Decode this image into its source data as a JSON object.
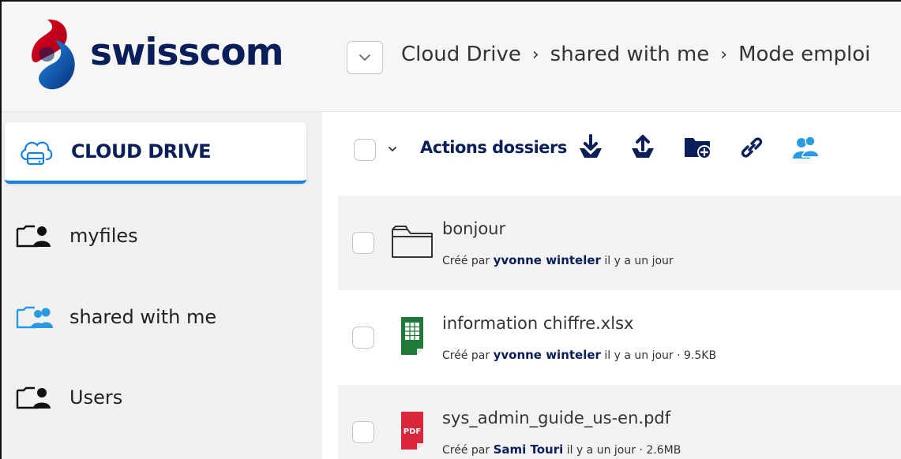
{
  "brand": {
    "name": "swisscom"
  },
  "breadcrumb": {
    "items": [
      "Cloud Drive",
      "shared with me",
      "Mode emploi"
    ],
    "separator": "›"
  },
  "sidebar": {
    "items": [
      {
        "label": "CLOUD DRIVE",
        "icon": "cloud-drive-icon",
        "active": true
      },
      {
        "label": "myfiles",
        "icon": "folder-user-icon"
      },
      {
        "label": "shared with me",
        "icon": "shared-folder-icon"
      },
      {
        "label": "Users",
        "icon": "folder-user-icon"
      }
    ]
  },
  "toolbar": {
    "actions_label": "Actions dossiers",
    "icons": [
      "download-icon",
      "upload-icon",
      "new-folder-icon",
      "link-icon",
      "share-users-icon"
    ]
  },
  "files": [
    {
      "name": "bonjour",
      "type": "folder",
      "created_prefix": "Créé par",
      "author": "yvonne winteler",
      "when": "il y a un jour",
      "size": ""
    },
    {
      "name": "information chiffre.xlsx",
      "type": "xlsx",
      "created_prefix": "Créé par",
      "author": "yvonne winteler",
      "when": "il y a un jour · 9.5KB",
      "size": "9.5KB"
    },
    {
      "name": "sys_admin_guide_us-en.pdf",
      "type": "pdf",
      "created_prefix": "Créé par",
      "author": "Sami Touri",
      "when": "il y a un jour · 2.6MB",
      "size": "2.6MB",
      "badge": "PDF"
    }
  ],
  "colors": {
    "navy": "#0a1e5a",
    "accent_blue": "#1781e3",
    "share_blue": "#2a9be0",
    "excel_green": "#1f7a3a",
    "pdf_red": "#d9263b"
  }
}
